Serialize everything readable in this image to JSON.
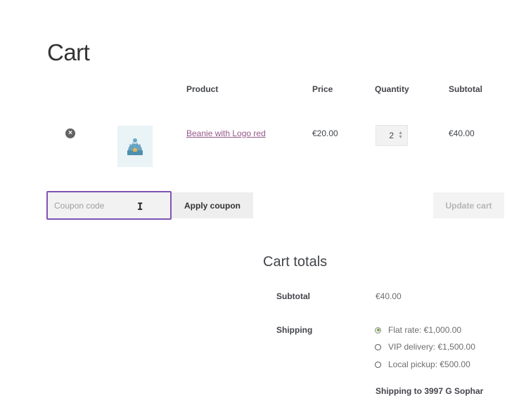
{
  "page": {
    "title": "Cart"
  },
  "table": {
    "headers": {
      "product": "Product",
      "price": "Price",
      "quantity": "Quantity",
      "subtotal": "Subtotal"
    },
    "items": [
      {
        "remove": "×",
        "product": "Beanie with Logo red",
        "price": "€20.00",
        "quantity": "2",
        "subtotal": "€40.00"
      }
    ]
  },
  "actions": {
    "coupon_placeholder": "Coupon code",
    "apply_coupon": "Apply coupon",
    "update_cart": "Update cart"
  },
  "totals": {
    "title": "Cart totals",
    "subtotal_label": "Subtotal",
    "subtotal_value": "€40.00",
    "shipping_label": "Shipping",
    "shipping_options": [
      {
        "label": "Flat rate: €1,000.00",
        "checked": true
      },
      {
        "label": "VIP delivery: €1,500.00",
        "checked": false
      },
      {
        "label": "Local pickup: €500.00",
        "checked": false
      }
    ],
    "shipping_destination": "Shipping to 3997 G Sophar"
  },
  "colors": {
    "accent": "#7f54b3",
    "link": "#96588a",
    "checked_radio": "#7aa34a"
  }
}
